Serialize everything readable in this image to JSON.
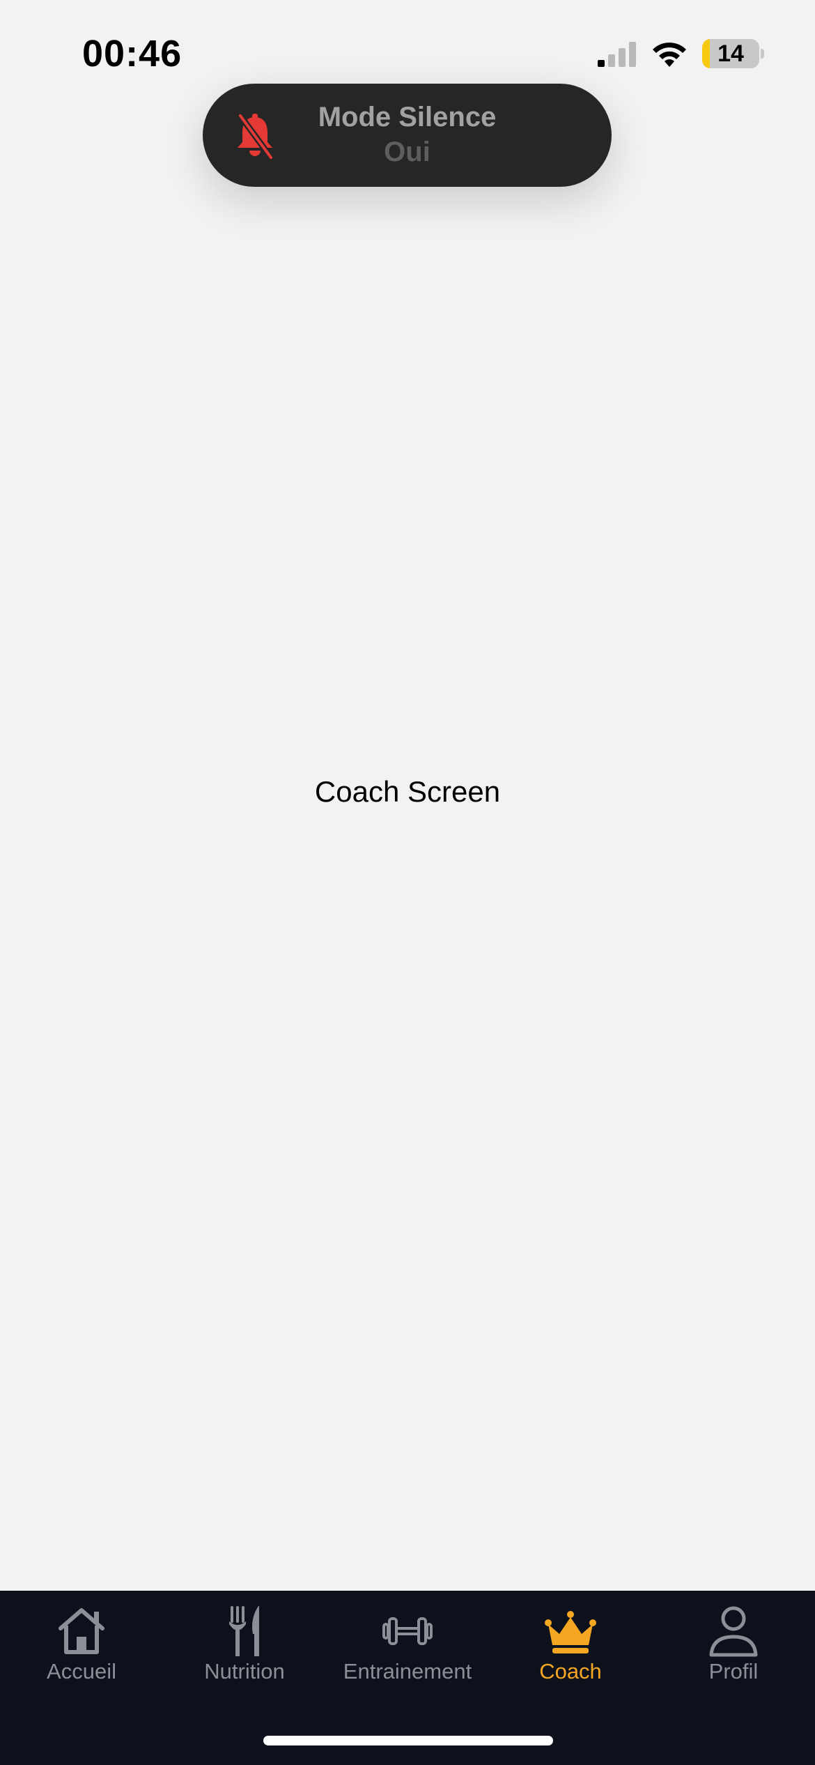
{
  "status_bar": {
    "time": "00:46",
    "battery_level": "14",
    "battery_fraction": 0.14,
    "signal_bars_active": 1,
    "icons": [
      "signal-icon",
      "wifi-icon",
      "battery-icon"
    ]
  },
  "silent_banner": {
    "title": "Mode Silence",
    "value": "Oui",
    "icon": "bell-slash-icon",
    "icon_color": "#e53935"
  },
  "main": {
    "text": "Coach Screen"
  },
  "tab_bar": {
    "active_color": "#f5a623",
    "inactive_color": "#8b8f98",
    "tabs": [
      {
        "label": "Accueil",
        "icon": "home-icon",
        "active": false
      },
      {
        "label": "Nutrition",
        "icon": "fork-knife-icon",
        "active": false
      },
      {
        "label": "Entrainement",
        "icon": "dumbbell-icon",
        "active": false
      },
      {
        "label": "Coach",
        "icon": "crown-icon",
        "active": true
      },
      {
        "label": "Profil",
        "icon": "person-icon",
        "active": false
      }
    ]
  }
}
